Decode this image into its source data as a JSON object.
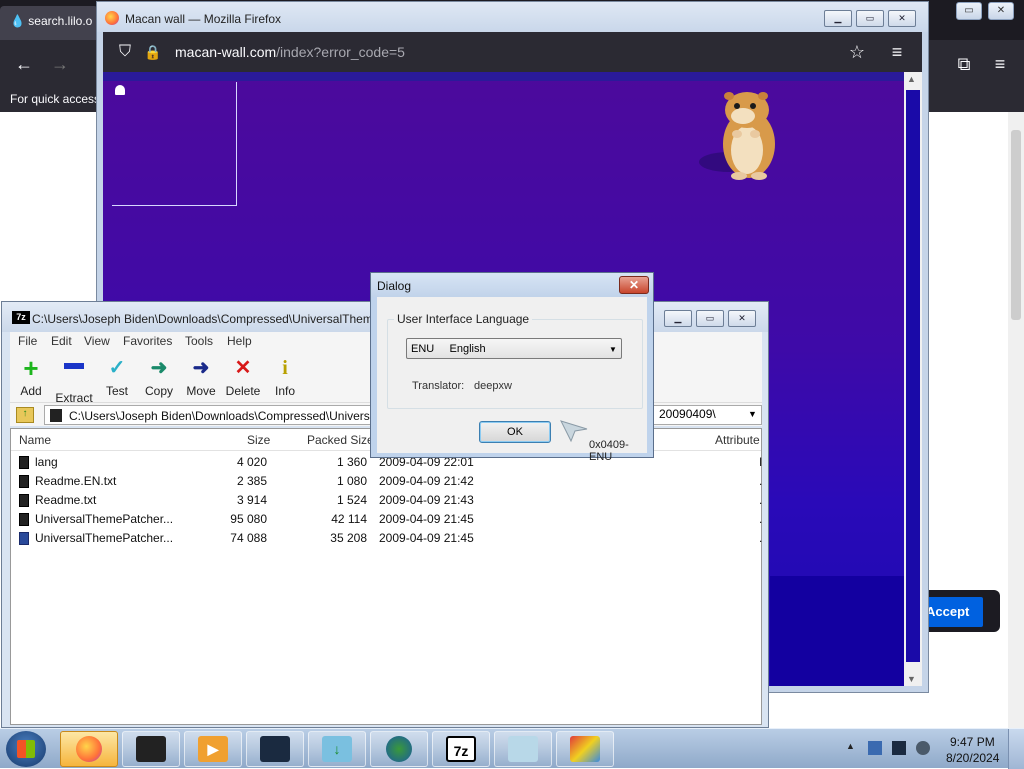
{
  "background_browser": {
    "tab_title": "search.lilo.o",
    "bookmarks_hint": "For quick access",
    "accept_label": "Accept"
  },
  "firefox": {
    "window_title": "Macan wall — Mozilla Firefox",
    "url_domain": "macan-wall.com",
    "url_path": "/index?error_code=5"
  },
  "sevenzip": {
    "window_title": "C:\\Users\\Joseph Biden\\Downloads\\Compressed\\UniversalTheme",
    "menu": [
      "File",
      "Edit",
      "View",
      "Favorites",
      "Tools",
      "Help"
    ],
    "toolbar": [
      {
        "label": "Add",
        "icon": "plus-icon",
        "color": "#1db51d",
        "glyph": "+"
      },
      {
        "label": "Extract",
        "icon": "minus-icon",
        "color": "#1a35c8",
        "glyph": "−"
      },
      {
        "label": "Test",
        "icon": "check-icon",
        "color": "#2ab0c8",
        "glyph": "✓"
      },
      {
        "label": "Copy",
        "icon": "copy-arrow-icon",
        "color": "#1a8a6a",
        "glyph": "➜"
      },
      {
        "label": "Move",
        "icon": "move-arrow-icon",
        "color": "#1a2a8a",
        "glyph": "➜"
      },
      {
        "label": "Delete",
        "icon": "delete-x-icon",
        "color": "#d81818",
        "glyph": "✕"
      },
      {
        "label": "Info",
        "icon": "info-icon",
        "color": "#b8a000",
        "glyph": "i"
      }
    ],
    "address": "C:\\Users\\Joseph Biden\\Downloads\\Compressed\\Universa",
    "address_tail": "20090409\\",
    "columns": {
      "name": "Name",
      "size": "Size",
      "packed": "Packed Size",
      "attributes": "Attribute"
    },
    "files": [
      {
        "name": "lang",
        "size": "4 020",
        "packed": "1 360",
        "modified": "2009-04-09 22:01",
        "attr": "I"
      },
      {
        "name": "Readme.EN.txt",
        "size": "2 385",
        "packed": "1 080",
        "modified": "2009-04-09 21:42",
        "attr": "."
      },
      {
        "name": "Readme.txt",
        "size": "3 914",
        "packed": "1 524",
        "modified": "2009-04-09 21:43",
        "attr": "."
      },
      {
        "name": "UniversalThemePatcher...",
        "size": "95 080",
        "packed": "42 114",
        "modified": "2009-04-09 21:45",
        "attr": "."
      },
      {
        "name": "UniversalThemePatcher...",
        "size": "74 088",
        "packed": "35 208",
        "modified": "2009-04-09 21:45",
        "attr": "."
      }
    ]
  },
  "dialog": {
    "title": "Dialog",
    "close_glyph": "✕",
    "group_label": "User Interface Language",
    "selected_language": "ENU     English",
    "translator_label": "Translator:",
    "translator_value": "deepxw",
    "ok_label": "OK",
    "code": "0x0409-ENU"
  },
  "taskbar": {
    "time": "9:47 PM",
    "date": "8/20/2024",
    "apps": [
      "firefox",
      "terminal",
      "media-player",
      "monitor",
      "downloader",
      "idm",
      "7zip",
      "notepad",
      "paint"
    ]
  },
  "colors": {
    "firefox_content_top": "#4c0a9c",
    "firefox_content_bottom": "#1a0ab0",
    "accept_blue": "#0061e0"
  }
}
